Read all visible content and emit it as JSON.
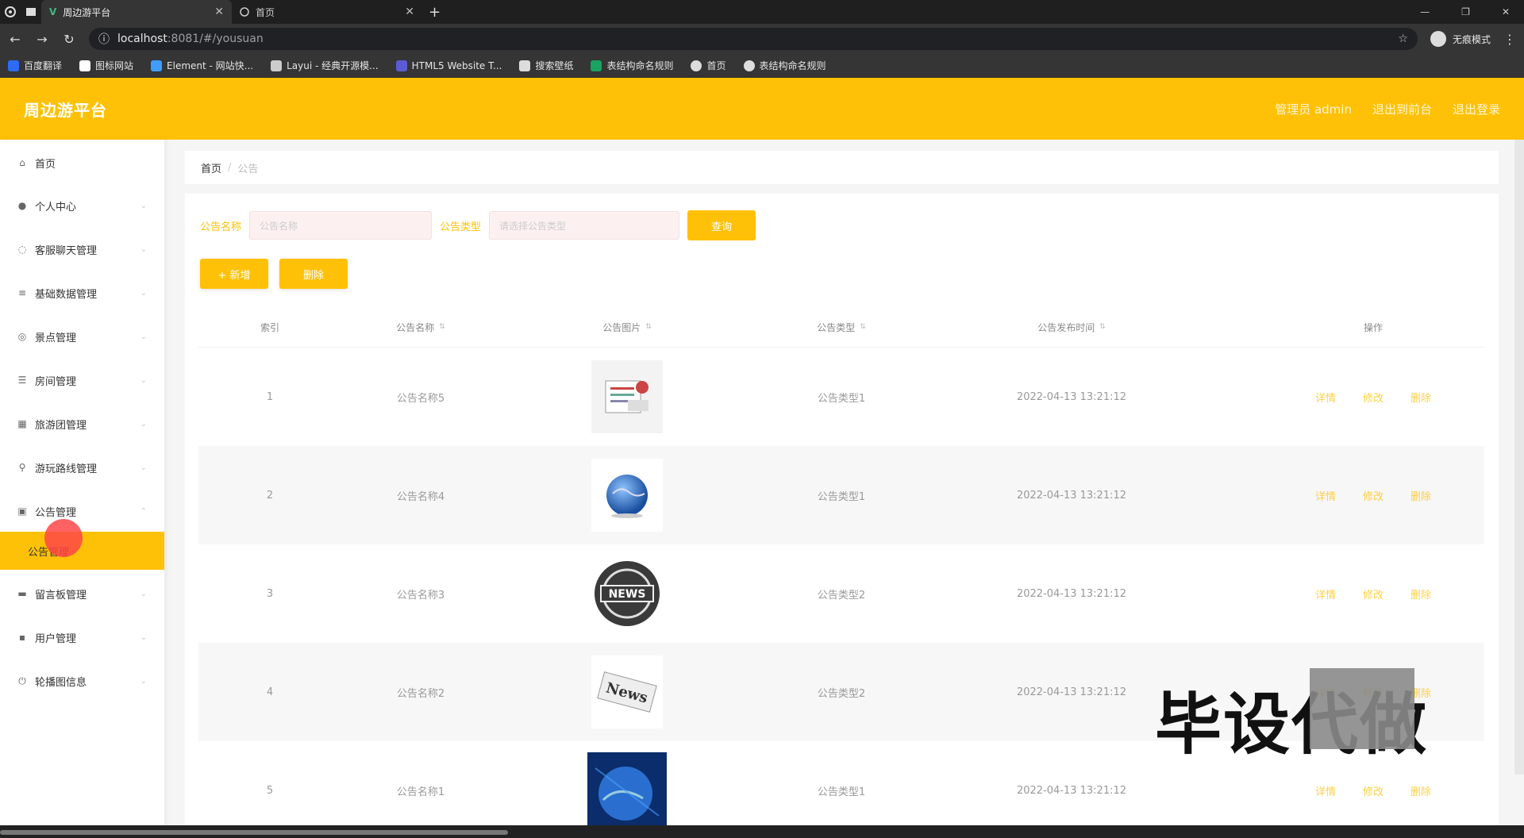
{
  "browser": {
    "tabs": [
      {
        "title": "周边游平台",
        "active": true
      },
      {
        "title": "首页",
        "active": false
      }
    ],
    "new_tab": "+",
    "url_host": "localhost",
    "url_path": ":8081/#/yousuan",
    "incognito_label": "无痕模式",
    "bookmarks": [
      {
        "label": "百度翻译",
        "color": "#2f6cf5"
      },
      {
        "label": "图标网站",
        "color": "#ffffff"
      },
      {
        "label": "Element - 网站快...",
        "color": "#409eff"
      },
      {
        "label": "Layui - 经典开源模...",
        "color": "#cccccc"
      },
      {
        "label": "HTML5 Website T...",
        "color": "#5b5bd6"
      },
      {
        "label": "搜索壁纸",
        "color": "#dddddd"
      },
      {
        "label": "表结构命名规则",
        "color": "#1aa260"
      },
      {
        "label": "首页",
        "color": "#dddddd"
      },
      {
        "label": "表结构命名规则",
        "color": "#dddddd"
      }
    ]
  },
  "header": {
    "title": "周边游平台",
    "user": "管理员 admin",
    "backend": "退出到前台",
    "logout": "退出登录"
  },
  "sidebar": {
    "items": [
      {
        "label": "首页",
        "icon": "home-icon"
      },
      {
        "label": "个人中心",
        "icon": "user-icon"
      },
      {
        "label": "客服聊天管理",
        "icon": "chat-icon"
      },
      {
        "label": "基础数据管理",
        "icon": "list-icon"
      },
      {
        "label": "景点管理",
        "icon": "compass-icon"
      },
      {
        "label": "房间管理",
        "icon": "filter-icon"
      },
      {
        "label": "旅游团管理",
        "icon": "grid-icon"
      },
      {
        "label": "游玩路线管理",
        "icon": "pin-icon"
      },
      {
        "label": "公告管理",
        "icon": "doc-icon"
      },
      {
        "label": "留言板管理",
        "icon": "message-icon"
      },
      {
        "label": "用户管理",
        "icon": "users-icon"
      },
      {
        "label": "轮播图信息",
        "icon": "power-icon"
      }
    ],
    "active_sub": "公告管理"
  },
  "breadcrumb": {
    "home": "首页",
    "current": "公告"
  },
  "search": {
    "label1": "公告名称",
    "placeholder1": "公告名称",
    "label2": "公告类型",
    "placeholder2": "请选择公告类型",
    "query_button": "查询"
  },
  "actions": {
    "add": "+ 新增",
    "delete": "删除"
  },
  "table": {
    "headers": {
      "index": "索引",
      "name": "公告名称",
      "image": "公告图片",
      "type": "公告类型",
      "time": "公告发布时间",
      "ops": "操作"
    },
    "rows": [
      {
        "index": "1",
        "name": "公告名称5",
        "type": "公告类型1",
        "time": "2022-04-13 13:21:12",
        "image": "document-thumbnail"
      },
      {
        "index": "2",
        "name": "公告名称4",
        "type": "公告类型1",
        "time": "2022-04-13 13:21:12",
        "image": "globe-thumbnail"
      },
      {
        "index": "3",
        "name": "公告名称3",
        "type": "公告类型2",
        "time": "2022-04-13 13:21:12",
        "image": "news-globe-thumbnail"
      },
      {
        "index": "4",
        "name": "公告名称2",
        "type": "公告类型2",
        "time": "2022-04-13 13:21:12",
        "image": "news-paper-thumbnail"
      },
      {
        "index": "5",
        "name": "公告名称1",
        "type": "公告类型1",
        "time": "2022-04-13 13:21:12",
        "image": "earth-thumbnail"
      }
    ],
    "op_labels": {
      "detail": "详情",
      "edit": "修改",
      "delete": "删除"
    }
  },
  "watermark": "毕设代做",
  "colors": {
    "accent": "#ffc107"
  }
}
